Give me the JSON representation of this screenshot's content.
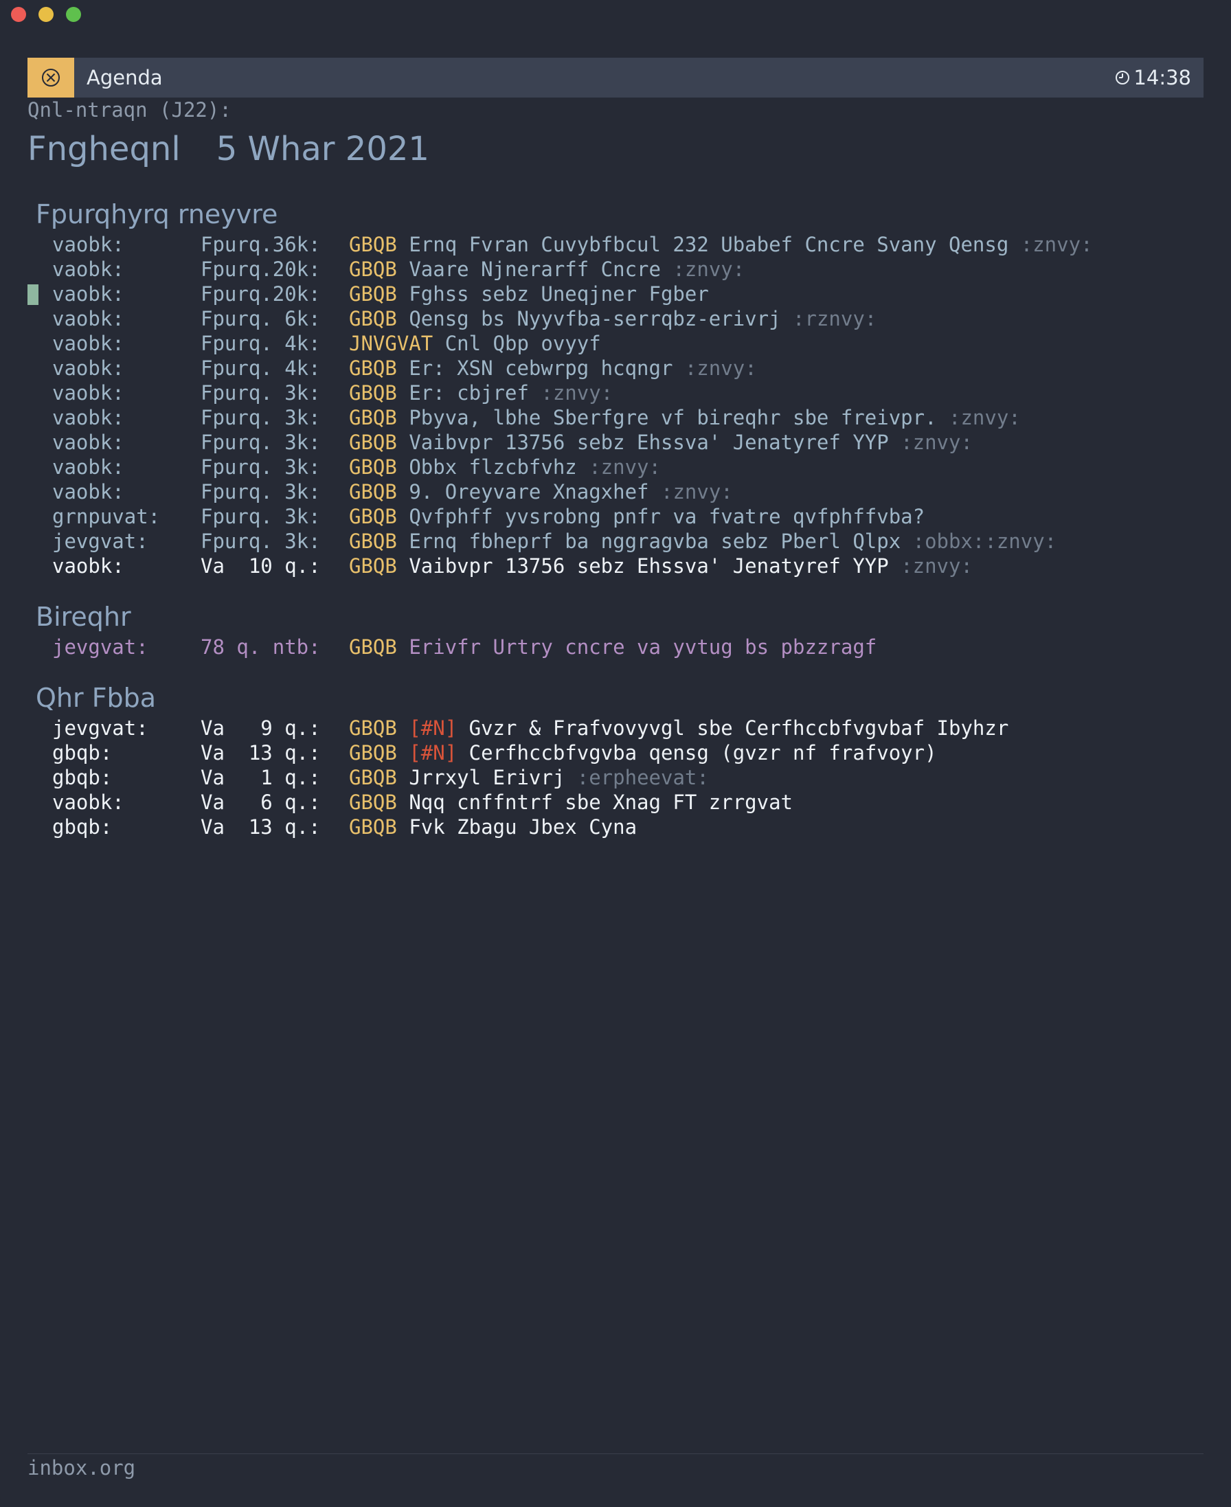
{
  "header": {
    "title": "Agenda",
    "time": "14:38"
  },
  "overview": "Qnl-ntraqn (J22):",
  "day": {
    "name": "Fngheqnl",
    "date": "5 Whar 2021"
  },
  "sections": {
    "scheduled": {
      "title": "Fpurqhyrq rneyvre",
      "rows": [
        {
          "cat": "vaobk:",
          "sched": "Fpurq.36k:",
          "kw": "GBQB",
          "text": "Ernq Fvran Cuvybfbcul 232 Ubabef Cncre Svany Qensg",
          "tag": ":znvy:"
        },
        {
          "cat": "vaobk:",
          "sched": "Fpurq.20k:",
          "kw": "GBQB",
          "text": "Vaare Njnerarff Cncre",
          "tag": ":znvy:"
        },
        {
          "cat": "vaobk:",
          "sched": "Fpurq.20k:",
          "kw": "GBQB",
          "text": "Fghss sebz Uneqjner Fgber",
          "tag": ""
        },
        {
          "cat": "vaobk:",
          "sched": "Fpurq. 6k:",
          "kw": "GBQB",
          "text": "Qensg bs Nyyvfba-serrqbz-erivrj",
          "tag": ":rznvy:"
        },
        {
          "cat": "vaobk:",
          "sched": "Fpurq. 4k:",
          "kw": "JNVGVAT",
          "text": "Cnl Qbp ovyyf",
          "tag": ""
        },
        {
          "cat": "vaobk:",
          "sched": "Fpurq. 4k:",
          "kw": "GBQB",
          "text": "Er: XSN cebwrpg hcqngr",
          "tag": ":znvy:"
        },
        {
          "cat": "vaobk:",
          "sched": "Fpurq. 3k:",
          "kw": "GBQB",
          "text": "Er: cbjref",
          "tag": ":znvy:"
        },
        {
          "cat": "vaobk:",
          "sched": "Fpurq. 3k:",
          "kw": "GBQB",
          "text": "Pbyva, lbhe Sberfgre vf bireqhr sbe freivpr.",
          "tag": ":znvy:"
        },
        {
          "cat": "vaobk:",
          "sched": "Fpurq. 3k:",
          "kw": "GBQB",
          "text": "Vaibvpr 13756 sebz Ehssva' Jenatyref YYP",
          "tag": ":znvy:"
        },
        {
          "cat": "vaobk:",
          "sched": "Fpurq. 3k:",
          "kw": "GBQB",
          "text": "Obbx flzcbfvhz",
          "tag": ":znvy:"
        },
        {
          "cat": "vaobk:",
          "sched": "Fpurq. 3k:",
          "kw": "GBQB",
          "text": "9. Oreyvare Xnagxhef",
          "tag": ":znvy:"
        },
        {
          "cat": "grnpuvat:",
          "sched": "Fpurq. 3k:",
          "kw": "GBQB",
          "text": "Qvfphff yvsrobng pnfr va fvatre qvfphffvba?",
          "tag": ""
        },
        {
          "cat": "jevgvat:",
          "sched": "Fpurq. 3k:",
          "kw": "GBQB",
          "text": "Ernq fbheprf ba nggragvba sebz Pberl Qlpx",
          "tag": ":obbx::znvy:"
        },
        {
          "cat": "vaobk:",
          "sched": "Va  10 q.:",
          "kw": "GBQB",
          "text": "Vaibvpr 13756 sebz Ehssva' Jenatyref YYP",
          "tag": ":znvy:"
        }
      ]
    },
    "overdue": {
      "title": "Bireqhr",
      "rows": [
        {
          "cat": "jevgvat:",
          "sched": "78 q. ntb:",
          "kw": "GBQB",
          "text": "Erivfr Urtry cncre va yvtug bs pbzzragf"
        }
      ]
    },
    "due_soon": {
      "title": "Qhr Fbba",
      "rows": [
        {
          "cat": "jevgvat:",
          "sched": "Va   9 q.:",
          "kw": "GBQB",
          "prio": "[#N]",
          "text": "Gvzr & Frafvovyvgl sbe Cerfhccbfvgvbaf Ibyhzr",
          "tag": ""
        },
        {
          "cat": "gbqb:",
          "sched": "Va  13 q.:",
          "kw": "GBQB",
          "prio": "[#N]",
          "text": "Cerfhccbfvgvba qensg (gvzr nf frafvoyr)",
          "tag": ""
        },
        {
          "cat": "gbqb:",
          "sched": "Va   1 q.:",
          "kw": "GBQB",
          "prio": "",
          "text": "Jrrxyl Erivrj",
          "tag": ":erpheevat:"
        },
        {
          "cat": "vaobk:",
          "sched": "Va   6 q.:",
          "kw": "GBQB",
          "prio": "",
          "text": "Nqq cnffntrf sbe Xnag FT zrrgvat",
          "tag": ""
        },
        {
          "cat": "gbqb:",
          "sched": "Va  13 q.:",
          "kw": "GBQB",
          "prio": "",
          "text": "Fvk Zbagu Jbex Cyna",
          "tag": ""
        }
      ]
    }
  },
  "footer": "inbox.org",
  "colors": {
    "background": "#262a35",
    "header": "#3b4252",
    "accent": "#e9b862",
    "keyword": "#e8c06b",
    "priority": "#d9543a",
    "overdue": "#b48fc4"
  }
}
